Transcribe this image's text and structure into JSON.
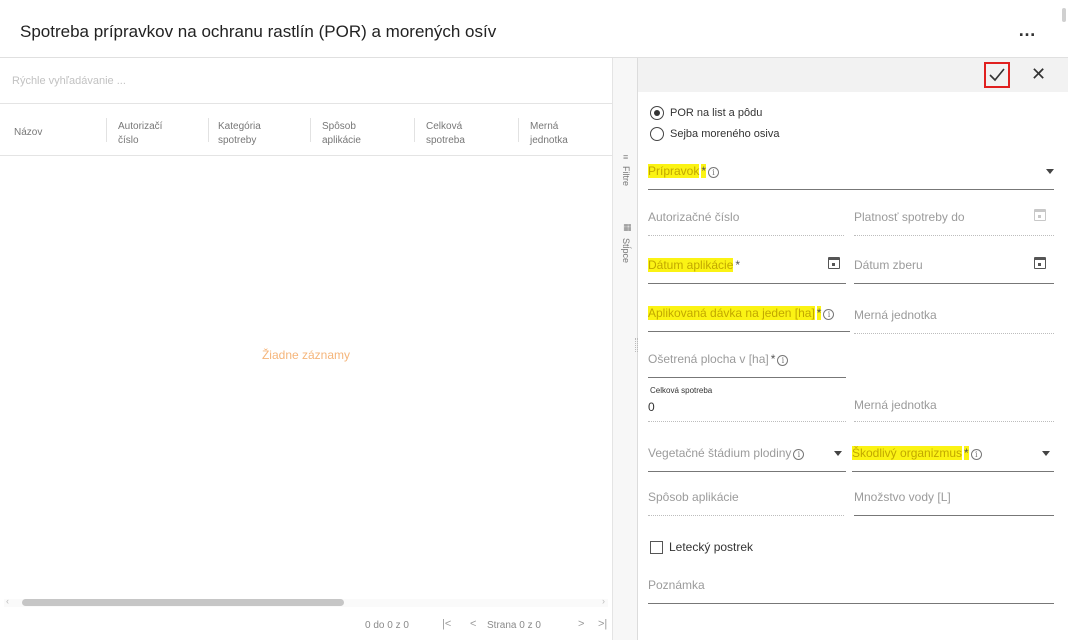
{
  "header": {
    "title": "Spotreba prípravkov na ochranu rastlín (POR) a morených osív",
    "more_label": "…"
  },
  "grid": {
    "search_placeholder": "Rýchle vyhľadávanie ...",
    "columns": [
      {
        "line1": "Názov",
        "line2": ""
      },
      {
        "line1": "Autorizačí",
        "line2": "číslo"
      },
      {
        "line1": "Kategória",
        "line2": "spotreby"
      },
      {
        "line1": "Spôsob",
        "line2": "aplikácie"
      },
      {
        "line1": "Celková",
        "line2": "spotreba"
      },
      {
        "line1": "Merná",
        "line2": "jednotka"
      }
    ],
    "no_rows": "Žiadne záznamy",
    "pager": {
      "range": "0 do 0 z 0",
      "page_text": "Strana 0 z 0"
    }
  },
  "side_strip": {
    "filter_tab": "Filtre",
    "columns_tab": "Stĺpce"
  },
  "form": {
    "radios": [
      {
        "label": "POR na list a pôdu",
        "selected": true
      },
      {
        "label": "Sejba moreného osiva",
        "selected": false
      }
    ],
    "pripravok": {
      "label": "Prípravok",
      "required": "*"
    },
    "autorizacne_cislo": {
      "label": "Autorizačné číslo"
    },
    "platnost": {
      "label": "Platnosť spotreby do"
    },
    "datum_aplikacie": {
      "label": "Dátum aplikácie",
      "required": "*"
    },
    "datum_zberu": {
      "label": "Dátum zberu"
    },
    "aplikovana_davka": {
      "label": "Aplikovaná dávka na jeden [ha]",
      "required": "*"
    },
    "merna_jednotka_1": {
      "label": "Merná jednotka"
    },
    "osetrena_plocha": {
      "label": "Ošetrená plocha v [ha]",
      "required": "*"
    },
    "celkova_spotreba": {
      "label": "Celková spotreba",
      "value": "0"
    },
    "merna_jednotka_2": {
      "label": "Merná jednotka"
    },
    "vegetacne_stadium": {
      "label": "Vegetačné štádium plodiny"
    },
    "skodlivy_organizmus": {
      "label": "Škodlivý organizmus",
      "required": "*"
    },
    "sposob_aplikacie": {
      "label": "Spôsob aplikácie"
    },
    "mnozstvo_vody": {
      "label": "Množstvo vody [L]"
    },
    "letecky_postrek": {
      "label": "Letecký postrek",
      "checked": false
    },
    "poznamka": {
      "label": "Poznámka"
    }
  },
  "colors": {
    "highlight": "#fbf314",
    "confirm_border": "#e0201f",
    "no_rows": "#f5b57a"
  }
}
